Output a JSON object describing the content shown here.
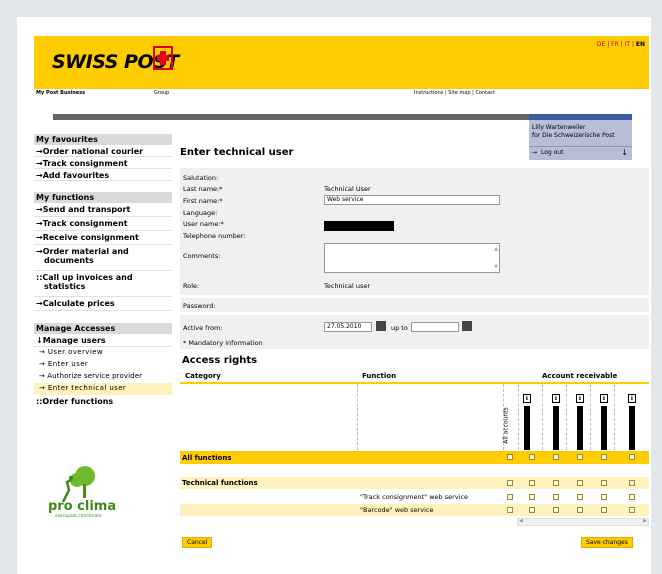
{
  "header": {
    "logo_text": "SWISS POST",
    "languages": [
      "DE",
      "FR",
      "IT",
      "EN"
    ],
    "active_language": "EN",
    "nav_left": [
      "My Post Business",
      "Group"
    ],
    "nav_right": [
      "Instructions",
      "Site map",
      "Contact"
    ]
  },
  "user": {
    "name": "Lilly Wartenweiler",
    "org": "for Die Schweizerische Post",
    "logout": "Log out"
  },
  "sidebar": {
    "favourites_title": "My favourites",
    "favourites": [
      "Order national courier",
      "Track consignment",
      "Add favourites"
    ],
    "functions_title": "My functions",
    "functions": [
      "Send and transport",
      "Track consignment",
      "Receive consignment",
      "Order material and documents",
      "Call up invoices and statistics",
      "Calculate prices"
    ],
    "manage_title": "Manage Accesses",
    "manage_users": "Manage users",
    "manage_items": [
      "User overview",
      "Enter user",
      "Authorize service provider",
      "Enter technical user"
    ],
    "order_functions": "Order functions",
    "climate_logo": "pro clima",
    "climate_sub": "swisspost.ch/climate"
  },
  "form": {
    "title": "Enter technical user",
    "salutation_label": "Salutation:",
    "lastname_label": "Last name:*",
    "lastname_value": "Technical User",
    "firstname_label": "First name:*",
    "firstname_value": "Web service",
    "language_label": "Language:",
    "username_label": "User name:*",
    "telephone_label": "Telephone number:",
    "comments_label": "Comments:",
    "role_label": "Role:",
    "role_value": "Technical user",
    "password_label": "Password:",
    "active_from_label": "Active from:",
    "active_from_value": "27.05.2010",
    "up_to_label": "up to",
    "mandatory_note": "* Mandatory information"
  },
  "access": {
    "title": "Access rights",
    "col_category": "Category",
    "col_function": "Function",
    "col_account": "Account receivable",
    "all_accounts": "All accounts",
    "rows": [
      {
        "category": "All functions",
        "function": "",
        "style": "yellow"
      },
      {
        "category": "Technical functions",
        "function": "",
        "style": "pale"
      },
      {
        "category": "",
        "function": "\"Track consignment\" web service",
        "style": "white"
      },
      {
        "category": "",
        "function": "\"Barcode\" web service",
        "style": "pale"
      }
    ]
  },
  "buttons": {
    "cancel": "Cancel",
    "save": "Save changes"
  },
  "colors": {
    "brand_yellow": "#ffcc00",
    "brand_red": "#c4003a",
    "user_blue": "#b9bed8"
  }
}
